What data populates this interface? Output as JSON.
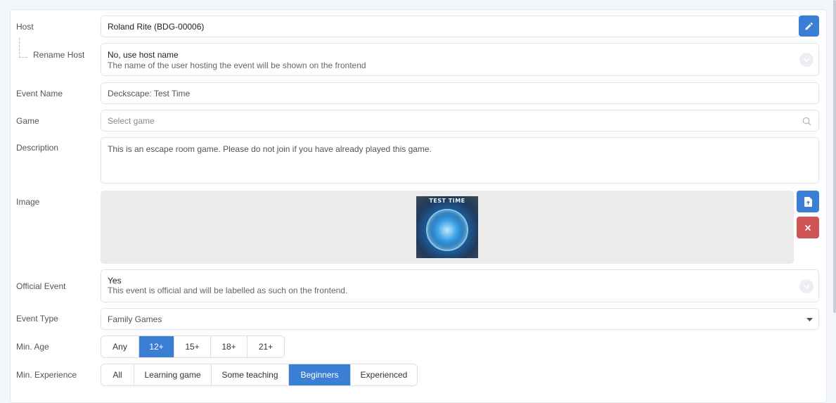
{
  "labels": {
    "host": "Host",
    "rename_host": "Rename Host",
    "event_name": "Event Name",
    "game": "Game",
    "description": "Description",
    "image": "Image",
    "official_event": "Official Event",
    "event_type": "Event Type",
    "min_age": "Min. Age",
    "min_experience": "Min. Experience"
  },
  "host": {
    "value": "Roland Rite (BDG-00006)",
    "edit_icon": "pencil-icon"
  },
  "rename_host": {
    "value": "No, use host name",
    "help": "The name of the user hosting the event will be shown on the frontend"
  },
  "event_name": {
    "value": "Deckscape: Test Time"
  },
  "game": {
    "placeholder": "Select game",
    "icon": "search-icon"
  },
  "description": {
    "value": "This is an escape room game.  Please do not join if you have already played this game."
  },
  "image": {
    "thumb_title": "TEST TIME",
    "upload_icon": "file-upload-icon",
    "remove_icon": "close-icon"
  },
  "official_event": {
    "value": "Yes",
    "help": "This event is official and will be labelled as such on the frontend."
  },
  "event_type": {
    "value": "Family Games"
  },
  "min_age": {
    "options": [
      "Any",
      "12+",
      "15+",
      "18+",
      "21+"
    ],
    "selected": "12+"
  },
  "min_experience": {
    "options": [
      "All",
      "Learning game",
      "Some teaching",
      "Beginners",
      "Experienced"
    ],
    "selected": "Beginners"
  },
  "colors": {
    "accent": "#3b7fd4",
    "danger": "#cf5555",
    "image_bg": "#ebebeb"
  }
}
